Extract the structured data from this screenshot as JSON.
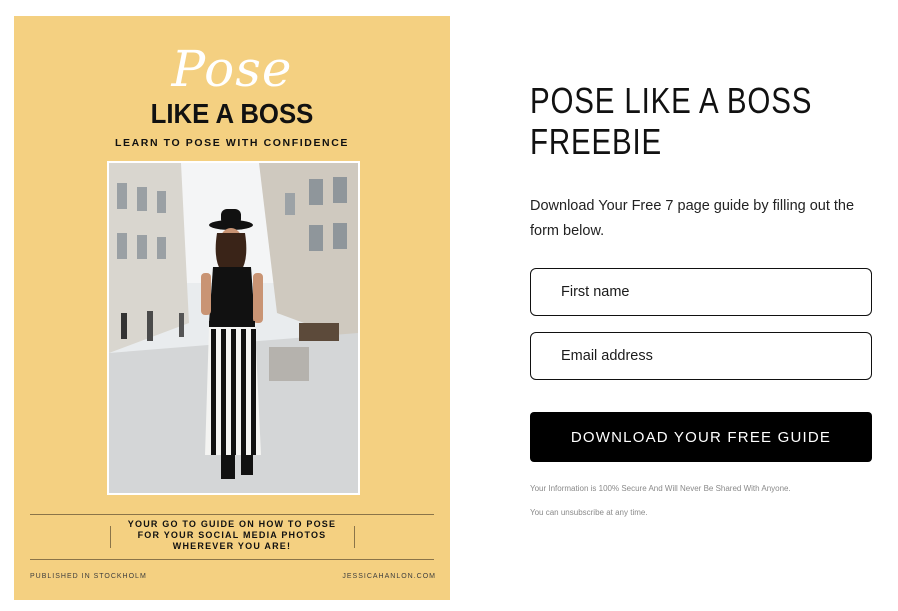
{
  "cover": {
    "script_title": "Pose",
    "title": "LIKE A BOSS",
    "subtitle": "LEARN TO POSE WITH CONFIDENCE",
    "tagline": [
      "YOUR GO TO GUIDE ON HOW TO POSE",
      "FOR YOUR SOCIAL MEDIA PHOTOS",
      "WHEREVER YOU ARE!"
    ],
    "footer_left": "PUBLISHED IN STOCKHOLM",
    "footer_right": "JESSICAHANLON.COM",
    "background_color": "#f4d081"
  },
  "form": {
    "heading_line1": "POSE LIKE A BOSS",
    "heading_line2": "FREEBIE",
    "description": "Download Your Free 7 page guide by filling out the form below.",
    "first_name_placeholder": "First name",
    "email_placeholder": "Email address",
    "submit_label": "DOWNLOAD YOUR FREE GUIDE",
    "privacy_note": "Your Information is 100% Secure And Will Never Be Shared With Anyone.",
    "unsubscribe_note": "You can unsubscribe at any time.",
    "button_color": "#000000"
  }
}
